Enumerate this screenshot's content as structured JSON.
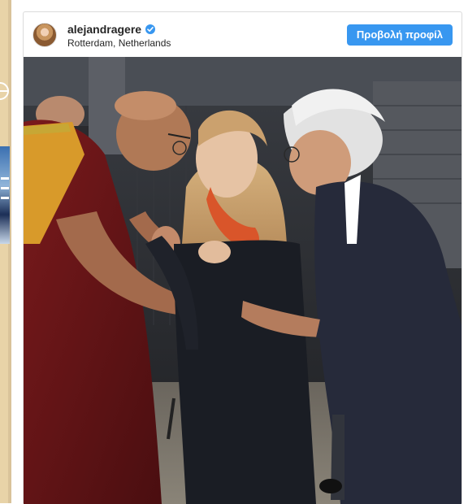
{
  "post": {
    "username": "alejandragere",
    "verified": true,
    "location": "Rotterdam, Netherlands",
    "view_profile_label": "Προβολή προφίλ"
  },
  "colors": {
    "accent": "#3897f0",
    "username": "#262626",
    "border": "#dbdbdb"
  },
  "icons": {
    "verified": "verified-badge-icon",
    "avatar": "profile-avatar"
  }
}
